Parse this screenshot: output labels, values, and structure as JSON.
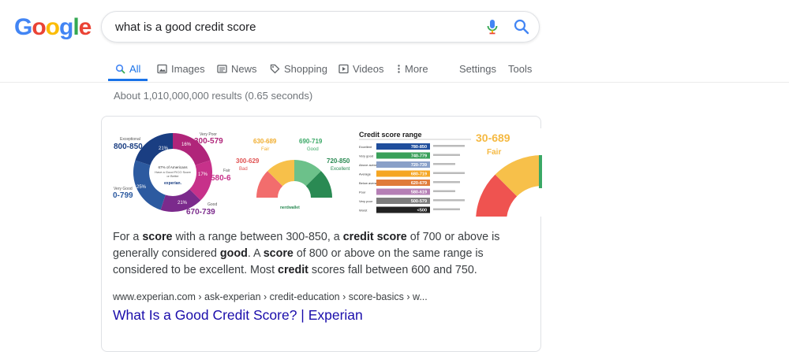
{
  "logo": {
    "text": "Google",
    "letters": [
      "G",
      "o",
      "o",
      "g",
      "l",
      "e"
    ],
    "colors": [
      "#4285F4",
      "#EA4335",
      "#FBBC05",
      "#4285F4",
      "#34A853",
      "#EA4335"
    ]
  },
  "search": {
    "query": "what is a good credit score",
    "mic_icon": "microphone-icon",
    "search_icon": "magnifier-icon"
  },
  "tabs": [
    {
      "label": "All",
      "icon": "search-icon",
      "active": true
    },
    {
      "label": "Images",
      "icon": "image-icon"
    },
    {
      "label": "News",
      "icon": "newspaper-icon"
    },
    {
      "label": "Shopping",
      "icon": "tag-icon"
    },
    {
      "label": "Videos",
      "icon": "play-icon"
    },
    {
      "label": "More",
      "icon": "dots-vertical-icon"
    },
    {
      "label": "Settings"
    },
    {
      "label": "Tools"
    }
  ],
  "stats": "About 1,010,000,000 results (0.65 seconds)",
  "images": {
    "donut": {
      "labels": [
        "Exceptional",
        "800-850",
        "Very Poor",
        "300-579",
        "Fair",
        "580-6",
        "Very Good",
        "0-799",
        "Good",
        "670-739"
      ],
      "percents": [
        "21%",
        "16%",
        "17%",
        "25%",
        "21%"
      ],
      "center_lines": [
        "67% of Americans",
        "Have a Good FICO Score",
        "or Better"
      ],
      "brand": "experian."
    },
    "gauge": {
      "bands": [
        {
          "range": "300-629",
          "label": "Bad"
        },
        {
          "range": "630-689",
          "label": "Fair"
        },
        {
          "range": "690-719",
          "label": "Good"
        },
        {
          "range": "720-850",
          "label": "Excellent"
        }
      ],
      "brand": "nerdwallet"
    },
    "table": {
      "title": "Credit score range",
      "rows": [
        {
          "label": "Excellent",
          "value": "780-850",
          "color": "#1f4e9c"
        },
        {
          "label": "Very good",
          "value": "740-779",
          "color": "#3aa05a"
        },
        {
          "label": "Above average",
          "value": "720-739",
          "color": "#8aa0c8"
        },
        {
          "label": "Average",
          "value": "680-719",
          "color": "#f5a623"
        },
        {
          "label": "Below average",
          "value": "620-679",
          "color": "#e07b3a"
        },
        {
          "label": "Poor",
          "value": "580-619",
          "color": "#b57fb5"
        },
        {
          "label": "Very poor",
          "value": "500-579",
          "color": "#7d7d7d"
        },
        {
          "label": "Worst",
          "value": "<500",
          "color": "#222222"
        }
      ]
    },
    "partial_gauge": {
      "range": "30-689",
      "label": "Fair"
    }
  },
  "result": {
    "snippet": [
      {
        "t": "For a ",
        "b": false
      },
      {
        "t": "score",
        "b": true
      },
      {
        "t": " with a range between 300-850, a ",
        "b": false
      },
      {
        "t": "credit score",
        "b": true
      },
      {
        "t": " of 700 or above is generally considered ",
        "b": false
      },
      {
        "t": "good",
        "b": true
      },
      {
        "t": ". A ",
        "b": false
      },
      {
        "t": "score",
        "b": true
      },
      {
        "t": " of 800 or above on the same range is considered to be excellent. Most ",
        "b": false
      },
      {
        "t": "credit",
        "b": true
      },
      {
        "t": " scores fall between 600 and 750.",
        "b": false
      }
    ],
    "url": "www.experian.com › ask-experian › credit-education › score-basics › w...",
    "title": "What Is a Good Credit Score? | Experian"
  }
}
